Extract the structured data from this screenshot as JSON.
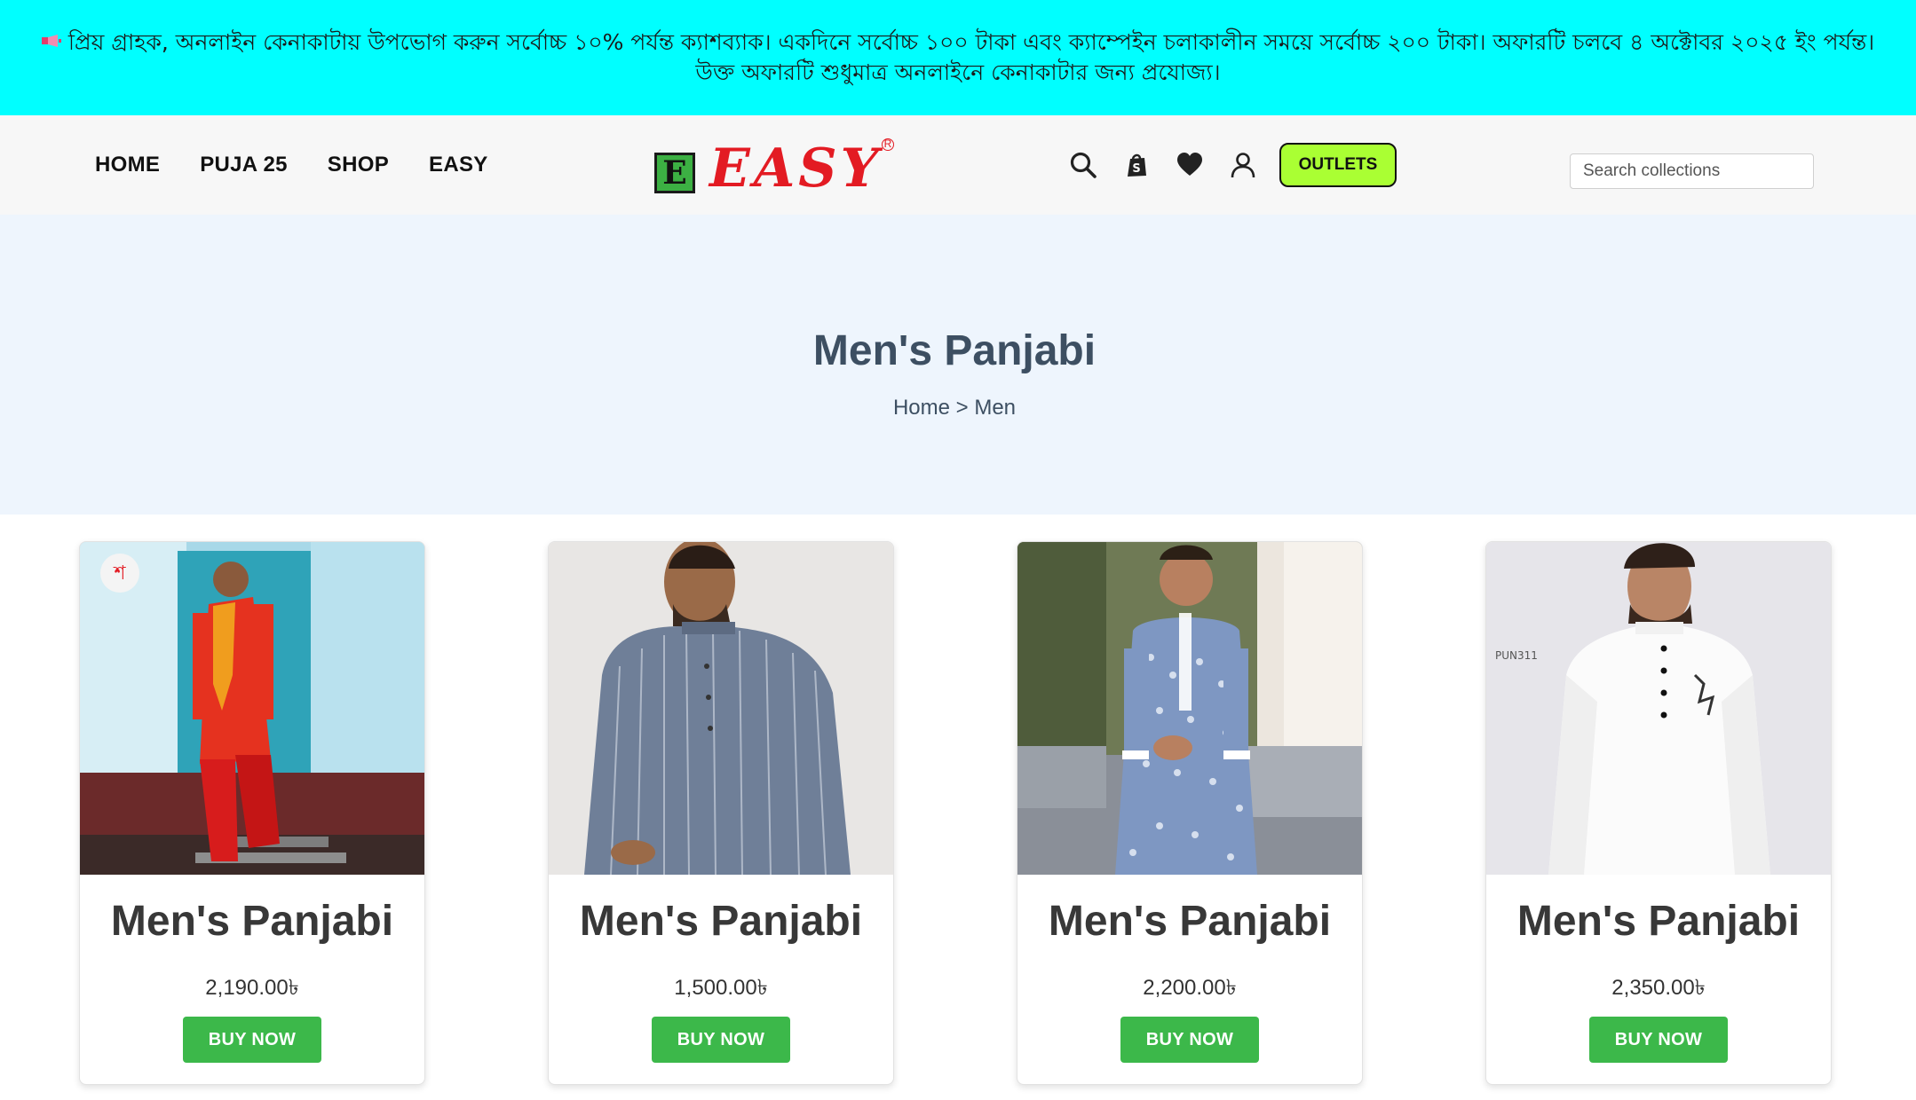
{
  "announcement": {
    "text": "প্রিয় গ্রাহক, অনলাইন কেনাকাটায় উপভোগ করুন সর্বোচ্চ ১০% পর্যন্ত ক্যাশব্যাক। একদিনে সর্বোচ্চ ১০০ টাকা এবং ক্যাম্পেইন চলাকালীন সময়ে সর্বোচ্চ ২০০ টাকা। অফারটি চলবে ৪ অক্টোবর ২০২৫ ইং পর্যন্ত। উক্ত অফারটি শুধুমাত্র অনলাইনে কেনাকাটার জন্য প্রযোজ্য।",
    "icon": "megaphone-icon",
    "background": "#00ffff"
  },
  "header": {
    "nav": [
      {
        "label": "HOME"
      },
      {
        "label": "PUJA 25"
      },
      {
        "label": "SHOP"
      },
      {
        "label": "EASY"
      }
    ],
    "logo": {
      "letter": "E",
      "text": "EASY",
      "brand_color": "#e31b23"
    },
    "icons": [
      "search-icon",
      "shopping-bag-icon",
      "heart-icon",
      "user-icon"
    ],
    "outlets_label": "OUTLETS",
    "outlets_color": "#aaff33",
    "search_placeholder": "Search collections"
  },
  "hero": {
    "title": "Men's Panjabi",
    "breadcrumb": {
      "home": "Home",
      "separator": ">",
      "current": "Men"
    },
    "background": "#eef5fd"
  },
  "products": [
    {
      "title": "Men's Panjabi",
      "price": "2,190.00৳",
      "button": "BUY NOW"
    },
    {
      "title": "Men's Panjabi",
      "price": "1,500.00৳",
      "button": "BUY NOW"
    },
    {
      "title": "Men's Panjabi",
      "price": "2,200.00৳",
      "button": "BUY NOW"
    },
    {
      "title": "Men's Panjabi",
      "price": "2,350.00৳",
      "button": "BUY NOW"
    }
  ],
  "colors": {
    "buy_button": "#3cb84a",
    "heading": "#3d4f62"
  }
}
